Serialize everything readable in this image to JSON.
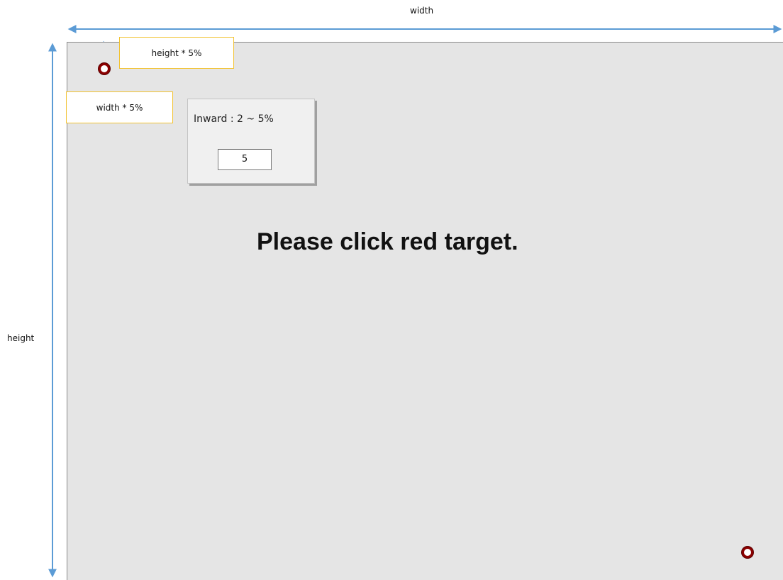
{
  "labels": {
    "width": "width",
    "height": "height",
    "height_pct": "height * 5%",
    "width_pct": "width * 5%"
  },
  "panel": {
    "label": "Inward : 2 ~ 5%",
    "value": "5"
  },
  "instruction": "Please click red target.",
  "colors": {
    "arrow": "#5b9bd5",
    "target": "#8b0000",
    "callout_border": "#f2c230",
    "screen_bg": "#e5e5e5"
  }
}
